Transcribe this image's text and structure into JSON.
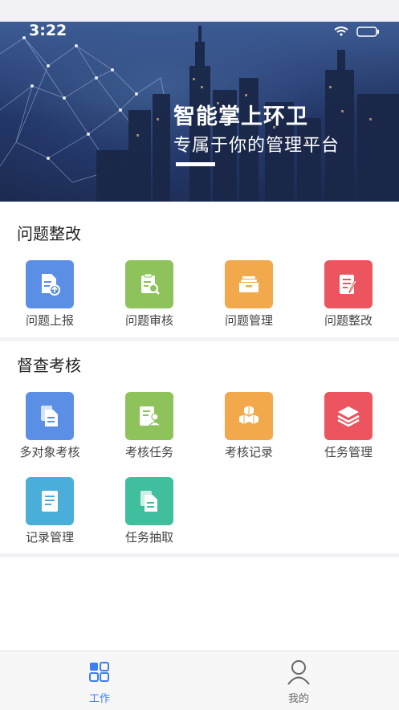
{
  "status_bar": {
    "time": "3:22"
  },
  "banner": {
    "title": "智能掌上环卫",
    "subtitle": "专属于你的管理平台"
  },
  "sections": [
    {
      "title": "问题整改",
      "items": [
        {
          "label": "问题上报",
          "icon": "document-upload-icon",
          "color": "#5b8fe6"
        },
        {
          "label": "问题审核",
          "icon": "clipboard-search-icon",
          "color": "#8dc35a"
        },
        {
          "label": "问题管理",
          "icon": "inbox-tray-icon",
          "color": "#f1a94b"
        },
        {
          "label": "问题整改",
          "icon": "edit-document-icon",
          "color": "#ec5560"
        }
      ]
    },
    {
      "title": "督查考核",
      "items": [
        {
          "label": "多对象考核",
          "icon": "copy-document-icon",
          "color": "#5b8fe6"
        },
        {
          "label": "考核任务",
          "icon": "user-document-icon",
          "color": "#8dc35a"
        },
        {
          "label": "考核记录",
          "icon": "cubes-icon",
          "color": "#f1a94b"
        },
        {
          "label": "任务管理",
          "icon": "layers-icon",
          "color": "#ec5560"
        },
        {
          "label": "记录管理",
          "icon": "notepad-icon",
          "color": "#4aaed9"
        },
        {
          "label": "任务抽取",
          "icon": "copy-file-icon",
          "color": "#3fbf9e"
        }
      ]
    }
  ],
  "tabbar": {
    "items": [
      {
        "label": "工作",
        "icon": "grid-icon",
        "color": "#3d7ef0"
      },
      {
        "label": "我的",
        "icon": "person-icon",
        "color": "#666666"
      }
    ]
  }
}
